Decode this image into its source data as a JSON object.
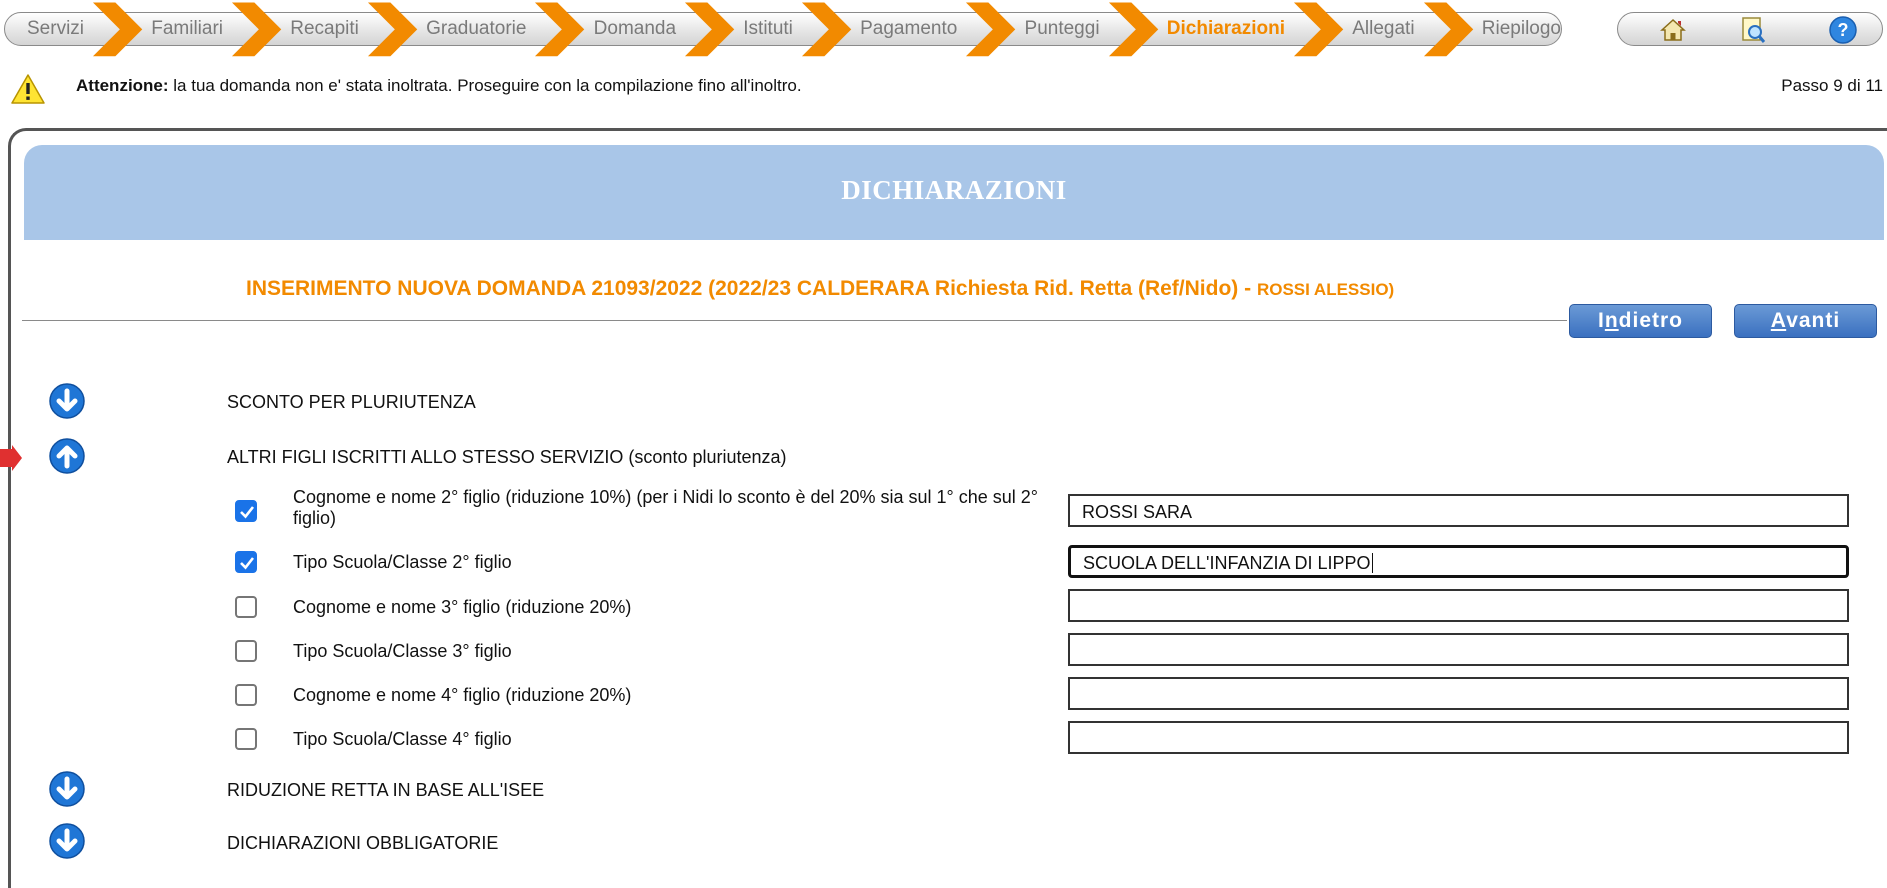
{
  "wizard": {
    "steps": [
      {
        "label": "Servizi",
        "active": false
      },
      {
        "label": "Familiari",
        "active": false
      },
      {
        "label": "Recapiti",
        "active": false
      },
      {
        "label": "Graduatorie",
        "active": false
      },
      {
        "label": "Domanda",
        "active": false
      },
      {
        "label": "Istituti",
        "active": false
      },
      {
        "label": "Pagamento",
        "active": false
      },
      {
        "label": "Punteggi",
        "active": false
      },
      {
        "label": "Dichiarazioni",
        "active": true
      },
      {
        "label": "Allegati",
        "active": false
      },
      {
        "label": "Riepilogo",
        "active": false
      }
    ],
    "arrow_color": "#f28a00",
    "active_color": "#f28a00"
  },
  "tools": {
    "icons": [
      "home-icon",
      "search-document-icon",
      "help-icon"
    ]
  },
  "warning": {
    "strong": "Attenzione:",
    "text": " la tua domanda non e' stata inoltrata. Proseguire con la compilazione fino all'inoltro.",
    "step": "Passo 9 di 11"
  },
  "page": {
    "title": "DICHIARAZIONI",
    "subtitle": "INSERIMENTO NUOVA DOMANDA 21093/2022 (2022/23 CALDERARA Richiesta Rid. Retta (Ref/Nido) - ",
    "subtitle_name": "ROSSI ALESSIO)",
    "banner_color": "#a9c6e8"
  },
  "buttons": {
    "back": {
      "pre": "I",
      "u": "n",
      "post": "dietro"
    },
    "next": {
      "pre": "",
      "u": "A",
      "post": "vanti"
    }
  },
  "sections": {
    "s1": "SCONTO PER PLURIUTENZA",
    "s2": "ALTRI FIGLI ISCRITTI ALLO STESSO SERVIZIO (sconto pluriutenza)",
    "s3": "RIDUZIONE RETTA IN BASE ALL'ISEE",
    "s4": "DICHIARAZIONI OBBLIGATORIE"
  },
  "rows": [
    {
      "label": "Cognome e nome 2° figlio (riduzione 10%) (per i Nidi lo sconto è del 20% sia sul 1° che sul 2° figlio)",
      "checked": true,
      "value": "ROSSI SARA"
    },
    {
      "label": "Tipo Scuola/Classe 2° figlio",
      "checked": true,
      "value": "SCUOLA DELL'INFANZIA DI LIPPO"
    },
    {
      "label": "Cognome e nome 3° figlio (riduzione 20%)",
      "checked": false,
      "value": ""
    },
    {
      "label": "Tipo Scuola/Classe 3° figlio",
      "checked": false,
      "value": ""
    },
    {
      "label": "Cognome e nome 4° figlio (riduzione 20%)",
      "checked": false,
      "value": ""
    },
    {
      "label": "Tipo Scuola/Classe 4° figlio",
      "checked": false,
      "value": ""
    }
  ]
}
